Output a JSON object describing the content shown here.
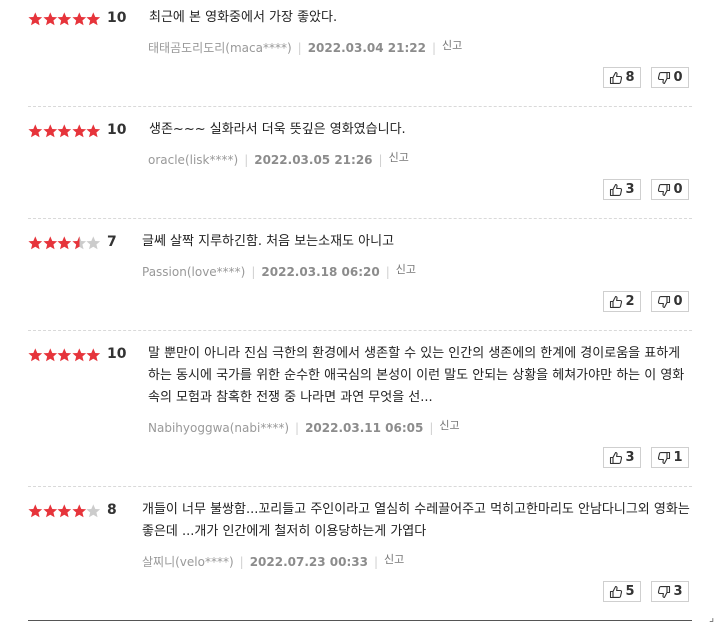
{
  "colors": {
    "star_on": "#e6343b",
    "star_off": "#cccccc"
  },
  "icons": {
    "like": "thumbs-up-icon",
    "dislike": "thumbs-down-icon"
  },
  "report_label": "신고",
  "reviews": [
    {
      "rating_stars": 5,
      "score": "10",
      "text": "최근에 본 영화중에서 가장 좋았다.",
      "author": "태태곰도리도리(maca****)",
      "date": "2022.03.04 21:22",
      "likes": "8",
      "dislikes": "0"
    },
    {
      "rating_stars": 5,
      "score": "10",
      "text": "생존~~~ 실화라서 더욱 뜻깊은 영화였습니다.",
      "author": "oracle(lisk****)",
      "date": "2022.03.05 21:26",
      "likes": "3",
      "dislikes": "0"
    },
    {
      "rating_stars": 3.5,
      "score": "7",
      "text": "글쎄 살짝 지루하긴함. 처음 보는소재도 아니고",
      "author": "Passion(love****)",
      "date": "2022.03.18 06:20",
      "likes": "2",
      "dislikes": "0"
    },
    {
      "rating_stars": 5,
      "score": "10",
      "text": "말 뿐만이 아니라 진심 극한의 환경에서 생존할 수 있는 인간의 생존에의 한계에 경이로움을 표하게 하는 동시에 국가를 위한 순수한 애국심의 본성이 이런 말도 안되는 상황을 헤쳐가야만 하는 이 영화 속의 모험과 참혹한 전쟁 중 나라면 과연 무엇을 선...",
      "author": "Nabihyoggwa(nabi****)",
      "date": "2022.03.11 06:05",
      "likes": "3",
      "dislikes": "1"
    },
    {
      "rating_stars": 4,
      "score": "8",
      "text": "개들이 너무 불쌍함...꼬리들고 주인이라고 열심히 수레끌어주고 먹히고한마리도 안남다니그외 영화는좋은데 ...개가 인간에게 철저히 이용당하는게 가엽다",
      "author": "살찌니(velo****)",
      "date": "2022.07.23 00:33",
      "likes": "5",
      "dislikes": "3"
    }
  ]
}
